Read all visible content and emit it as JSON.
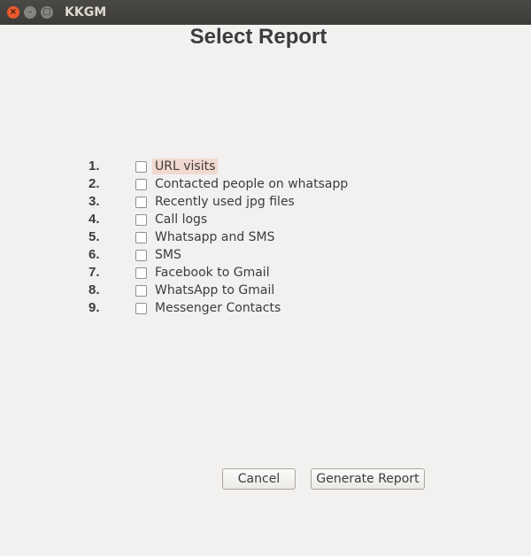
{
  "window": {
    "title": "KKGM",
    "close_glyph": "×",
    "minimize_glyph": "–",
    "maximize_glyph": "□"
  },
  "heading": "Select Report",
  "reports": [
    {
      "number": "1.",
      "label": "URL visits",
      "checked": false,
      "focused": true
    },
    {
      "number": "2.",
      "label": "Contacted people on whatsapp",
      "checked": false
    },
    {
      "number": "3.",
      "label": "Recently used jpg files",
      "checked": false
    },
    {
      "number": "4.",
      "label": "Call logs",
      "checked": false
    },
    {
      "number": "5.",
      "label": "Whatsapp and SMS",
      "checked": false
    },
    {
      "number": "6.",
      "label": "SMS",
      "checked": false
    },
    {
      "number": "7.",
      "label": "Facebook to Gmail",
      "checked": false
    },
    {
      "number": "8.",
      "label": "WhatsApp to Gmail",
      "checked": false
    },
    {
      "number": "9.",
      "label": "Messenger Contacts",
      "checked": false
    }
  ],
  "buttons": {
    "cancel": "Cancel",
    "generate": "Generate Report"
  },
  "colors": {
    "titlebar": "#3c3b37",
    "close_button": "#e9592c",
    "background": "#f2f1f0",
    "focus_highlight": "#f2d9cf"
  }
}
